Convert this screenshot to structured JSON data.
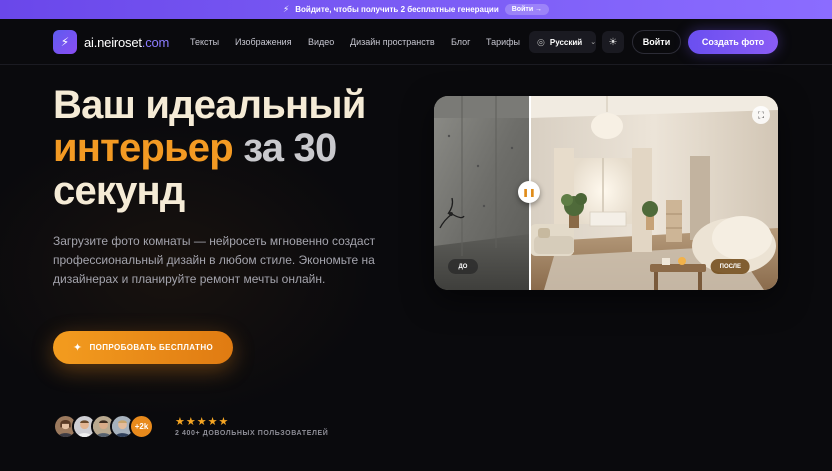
{
  "promo": {
    "text": "Войдите, чтобы получить 2 бесплатные генерации",
    "button": "Войти →"
  },
  "header": {
    "logo_name": "ai.neiroset",
    "logo_tld": ".com",
    "nav": [
      "Тексты",
      "Изображения",
      "Видео",
      "Дизайн пространств",
      "Блог",
      "Тарифы"
    ],
    "language": "Русский",
    "login": "Войти",
    "create": "Создать фото"
  },
  "hero": {
    "title_line1": "Ваш идеальный",
    "title_accent": "интерьер",
    "title_rest": " за 30",
    "title_line3": "секунд",
    "description": "Загрузите фото комнаты — нейросеть мгновенно создаст профессиональный дизайн в любом стиле. Экономьте на дизайнерах и планируйте ремонт мечты онлайн.",
    "cta": "ПОПРОБОВАТЬ БЕСПЛАТНО",
    "avatars_more": "+2k",
    "stars": "★★★★★",
    "rating_count": 5,
    "users_text": "2 400+ ДОВОЛЬНЫХ ПОЛЬЗОВАТЕЛЕЙ"
  },
  "comparison": {
    "before_label": "ДО",
    "after_label": "ПОСЛЕ",
    "pause_glyph": "❚❚",
    "expand_glyph": "⛶",
    "slider_position": 0.28
  },
  "colors": {
    "accent_orange": "#f39a23",
    "accent_purple": "#7b5cf5",
    "background": "#0a0a0d"
  },
  "icons": {
    "promo": "bolt-icon",
    "logo": "bolt-icon",
    "language": "globe-icon",
    "theme": "sun-icon",
    "cta": "sparkle-icon"
  }
}
